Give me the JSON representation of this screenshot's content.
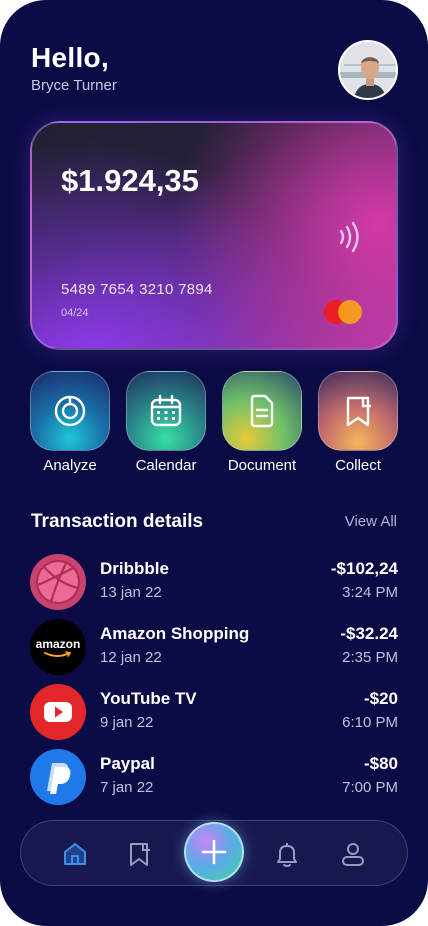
{
  "header": {
    "greeting": "Hello,",
    "user_name": "Bryce Turner"
  },
  "card": {
    "balance": "$1.924,35",
    "number": "5489 7654 3210 7894",
    "expiry": "04/24",
    "network_icon": "mastercard-icon",
    "contactless_icon": "contactless-icon"
  },
  "actions": [
    {
      "label": "Analyze",
      "icon": "analyze-icon"
    },
    {
      "label": "Calendar",
      "icon": "calendar-icon"
    },
    {
      "label": "Document",
      "icon": "document-icon"
    },
    {
      "label": "Collect",
      "icon": "bookmark-icon"
    }
  ],
  "transactions": {
    "title": "Transaction details",
    "view_all": "View All",
    "items": [
      {
        "name": "Dribbble",
        "date": "13 jan 22",
        "amount": "-$102,24",
        "time": "3:24 PM",
        "logo": "dribbble-logo"
      },
      {
        "name": "Amazon Shopping",
        "date": "12 jan 22",
        "amount": "-$32.24",
        "time": "2:35 PM",
        "logo": "amazon-logo",
        "logo_text": "amazon"
      },
      {
        "name": "YouTube TV",
        "date": "9 jan 22",
        "amount": "-$20",
        "time": "6:10 PM",
        "logo": "youtube-logo"
      },
      {
        "name": "Paypal",
        "date": "7 jan 22",
        "amount": "-$80",
        "time": "7:00 PM",
        "logo": "paypal-logo"
      }
    ]
  },
  "nav": {
    "items": [
      "home-icon",
      "bookmark-icon",
      "add-icon",
      "bell-icon",
      "user-icon"
    ],
    "active": "home-icon"
  },
  "colors": {
    "background": "#0b0b45",
    "accent_blue": "#3b8ff0",
    "dribbble": "#c8436d",
    "youtube": "#e3262a",
    "paypal": "#1f79e8"
  }
}
